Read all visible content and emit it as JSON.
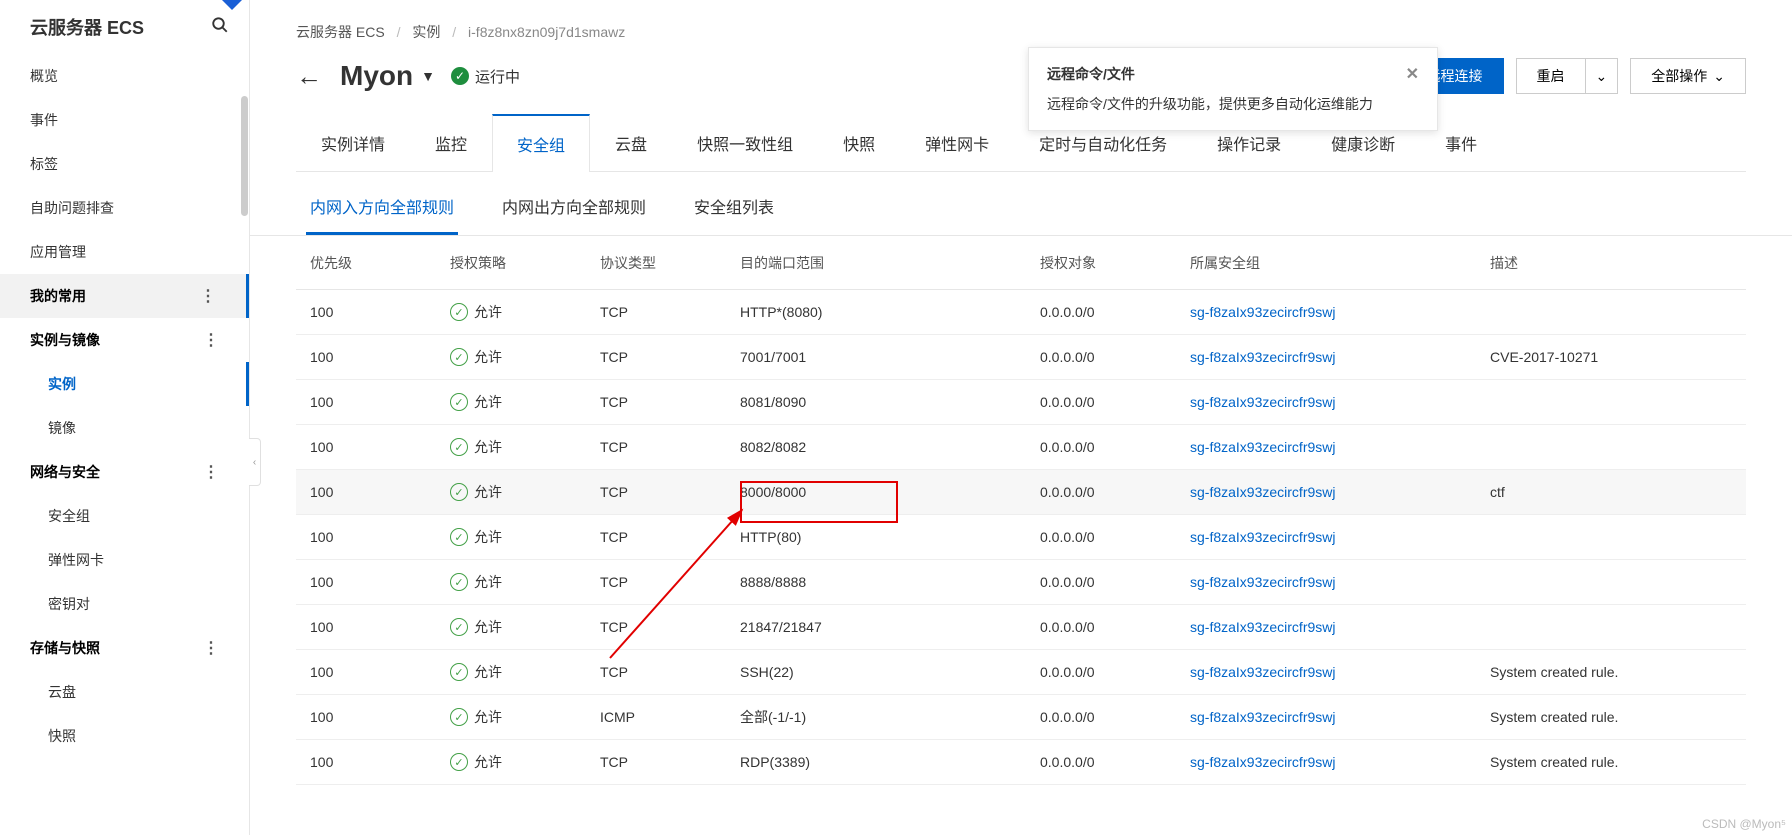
{
  "sidebar": {
    "title": "云服务器 ECS",
    "items": [
      {
        "label": "概览",
        "kind": "item"
      },
      {
        "label": "事件",
        "kind": "item"
      },
      {
        "label": "标签",
        "kind": "item"
      },
      {
        "label": "自助问题排查",
        "kind": "item"
      },
      {
        "label": "应用管理",
        "kind": "item"
      },
      {
        "label": "我的常用",
        "kind": "section",
        "highlight": true,
        "dots": true
      },
      {
        "label": "实例与镜像",
        "kind": "section",
        "dots": true
      },
      {
        "label": "实例",
        "kind": "sub",
        "active": true
      },
      {
        "label": "镜像",
        "kind": "sub"
      },
      {
        "label": "网络与安全",
        "kind": "section",
        "dots": true
      },
      {
        "label": "安全组",
        "kind": "sub"
      },
      {
        "label": "弹性网卡",
        "kind": "sub"
      },
      {
        "label": "密钥对",
        "kind": "sub"
      },
      {
        "label": "存储与快照",
        "kind": "section",
        "dots": true
      },
      {
        "label": "云盘",
        "kind": "sub"
      },
      {
        "label": "快照",
        "kind": "sub"
      }
    ]
  },
  "breadcrumb": {
    "a": "云服务器 ECS",
    "b": "实例",
    "c": "i-f8z8nx8zn09j7d1smawz"
  },
  "header": {
    "title": "Myon",
    "status": "运行中",
    "remote_btn": "远程连接",
    "restart_btn": "重启",
    "all_ops_btn": "全部操作"
  },
  "tooltip": {
    "title": "远程命令/文件",
    "body": "远程命令/文件的升级功能，提供更多自动化运维能力"
  },
  "tabs": [
    "实例详情",
    "监控",
    "安全组",
    "云盘",
    "快照一致性组",
    "快照",
    "弹性网卡",
    "定时与自动化任务",
    "操作记录",
    "健康诊断",
    "事件"
  ],
  "active_tab": 2,
  "sub_tabs": [
    "内网入方向全部规则",
    "内网出方向全部规则",
    "安全组列表"
  ],
  "active_sub_tab": 0,
  "table": {
    "headers": [
      "优先级",
      "授权策略",
      "协议类型",
      "目的端口范围",
      "授权对象",
      "所属安全组",
      "描述"
    ],
    "policy_label": "允许",
    "sg_link": "sg-f8zaIx93zecircfr9swj",
    "rows": [
      {
        "priority": "100",
        "proto": "TCP",
        "port": "HTTP*(8080)",
        "obj": "0.0.0.0/0",
        "desc": ""
      },
      {
        "priority": "100",
        "proto": "TCP",
        "port": "7001/7001",
        "obj": "0.0.0.0/0",
        "desc": "CVE-2017-10271"
      },
      {
        "priority": "100",
        "proto": "TCP",
        "port": "8081/8090",
        "obj": "0.0.0.0/0",
        "desc": ""
      },
      {
        "priority": "100",
        "proto": "TCP",
        "port": "8082/8082",
        "obj": "0.0.0.0/0",
        "desc": ""
      },
      {
        "priority": "100",
        "proto": "TCP",
        "port": "8000/8000",
        "obj": "0.0.0.0/0",
        "desc": "ctf",
        "highlight": true,
        "hover": true
      },
      {
        "priority": "100",
        "proto": "TCP",
        "port": "HTTP(80)",
        "obj": "0.0.0.0/0",
        "desc": ""
      },
      {
        "priority": "100",
        "proto": "TCP",
        "port": "8888/8888",
        "obj": "0.0.0.0/0",
        "desc": ""
      },
      {
        "priority": "100",
        "proto": "TCP",
        "port": "21847/21847",
        "obj": "0.0.0.0/0",
        "desc": ""
      },
      {
        "priority": "100",
        "proto": "TCP",
        "port": "SSH(22)",
        "obj": "0.0.0.0/0",
        "desc": "System created rule."
      },
      {
        "priority": "100",
        "proto": "ICMP",
        "port": "全部(-1/-1)",
        "obj": "0.0.0.0/0",
        "desc": "System created rule."
      },
      {
        "priority": "100",
        "proto": "TCP",
        "port": "RDP(3389)",
        "obj": "0.0.0.0/0",
        "desc": "System created rule."
      }
    ]
  },
  "watermark": "CSDN @Myon⁵"
}
